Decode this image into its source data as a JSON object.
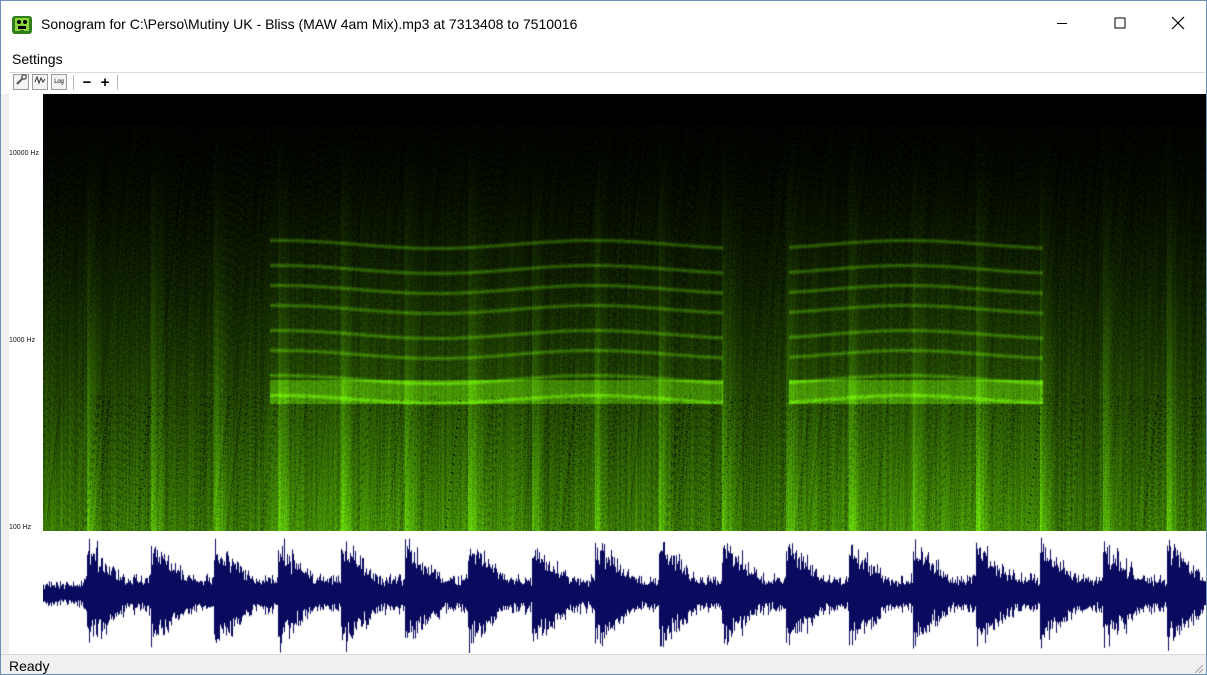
{
  "window": {
    "title": "Sonogram for C:\\Perso\\Mutiny UK - Bliss (MAW 4am Mix).mp3 at 7313408 to 7510016",
    "icon": "app-green-figure-icon"
  },
  "menu": {
    "settings_label": "Settings"
  },
  "toolbar": {
    "log_label": "Log",
    "minus_label": "−",
    "plus_label": "+"
  },
  "axis": {
    "labels": [
      "10000 Hz",
      "1000 Hz",
      "100 Hz"
    ]
  },
  "status": {
    "text": "Ready"
  },
  "colors": {
    "spectrum": "#7fd400",
    "background": "#000000",
    "waveform": "#0a0a5e"
  },
  "window_controls": [
    "minimize-icon",
    "maximize-icon",
    "close-icon"
  ]
}
